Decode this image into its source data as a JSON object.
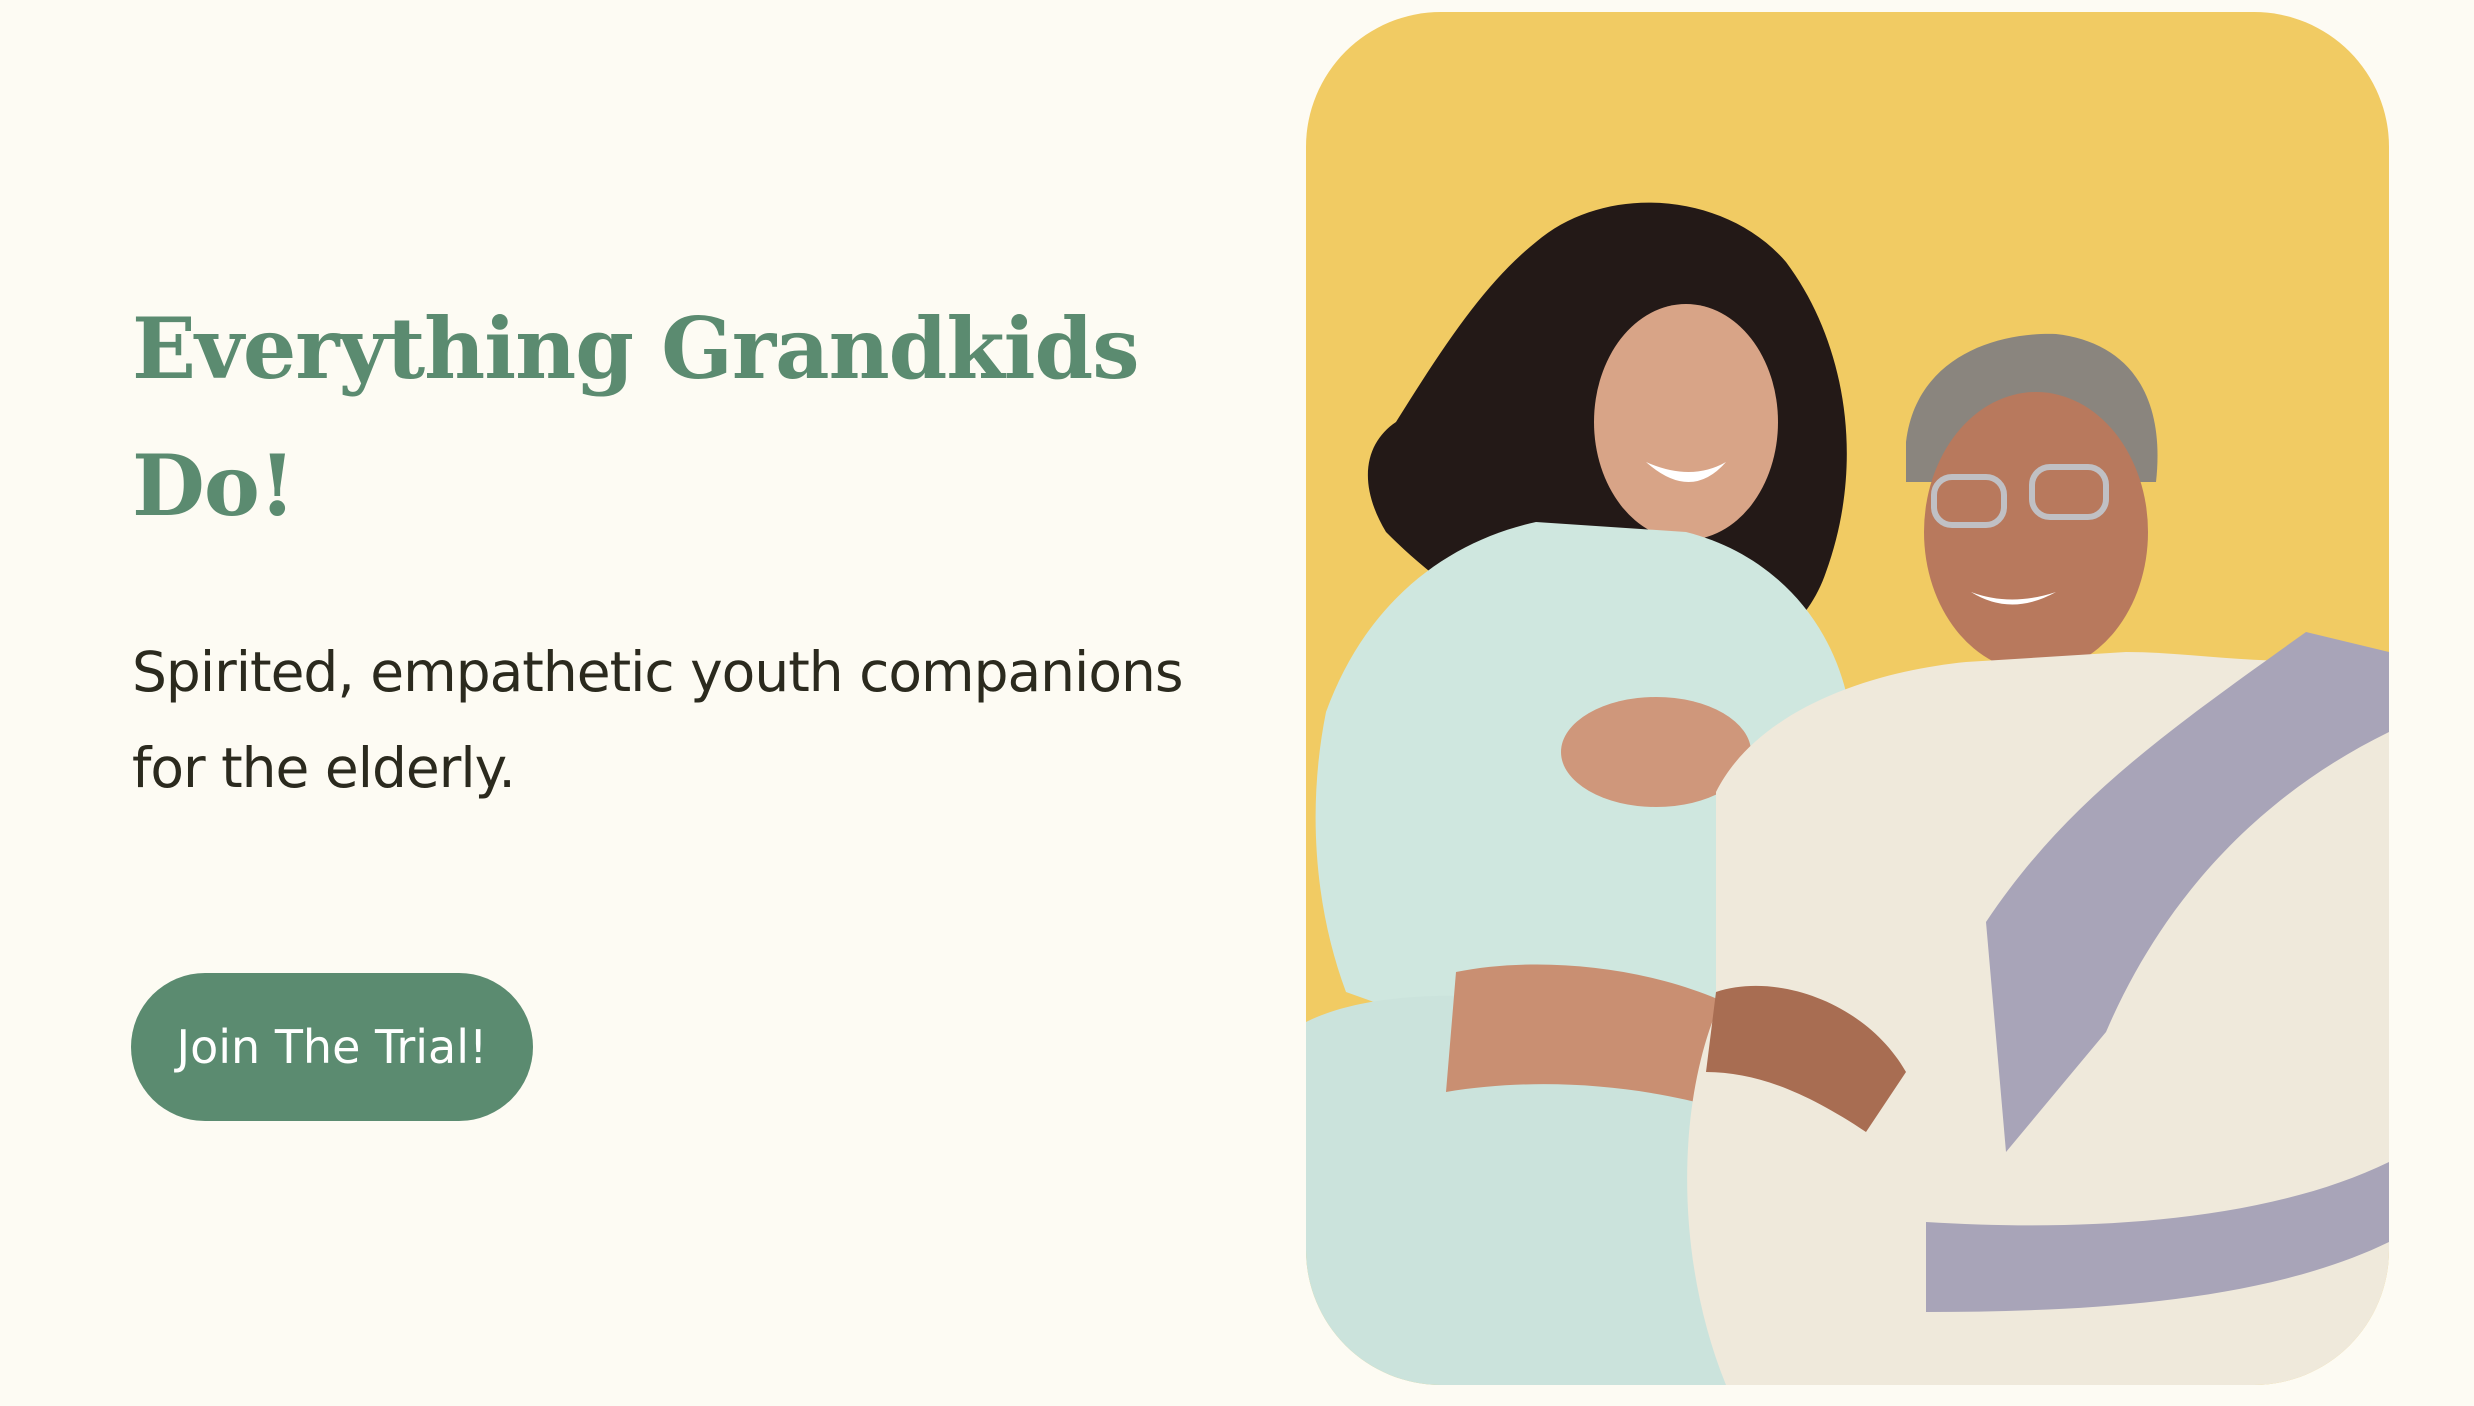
{
  "hero": {
    "title": "Everything Grandkids Do!",
    "subtitle": "Spirited, empathetic youth companions for the elderly.",
    "cta_label": "Join The Trial!"
  },
  "colors": {
    "background": "#fdfbf3",
    "accent": "#5b8b70",
    "text": "#2b2a1e",
    "photo_backdrop": "#f1cb63"
  }
}
